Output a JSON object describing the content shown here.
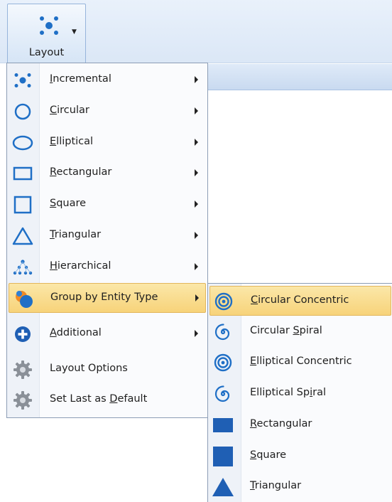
{
  "ribbon": {
    "layout_button": {
      "label": "Layout",
      "icon": "layout-dots-icon"
    }
  },
  "menu": {
    "items": [
      {
        "pre": "",
        "key": "I",
        "post": "ncremental",
        "icon": "incremental-dots-icon",
        "submenu": true
      },
      {
        "pre": "",
        "key": "C",
        "post": "ircular",
        "icon": "circle-outline-icon",
        "submenu": true
      },
      {
        "pre": "",
        "key": "E",
        "post": "lliptical",
        "icon": "ellipse-outline-icon",
        "submenu": true
      },
      {
        "pre": "",
        "key": "R",
        "post": "ectangular",
        "icon": "rectangle-outline-icon",
        "submenu": true
      },
      {
        "pre": "",
        "key": "S",
        "post": "quare",
        "icon": "square-outline-icon",
        "submenu": true
      },
      {
        "pre": "",
        "key": "T",
        "post": "riangular",
        "icon": "triangle-outline-icon",
        "submenu": true
      },
      {
        "pre": "",
        "key": "H",
        "post": "ierarchical",
        "icon": "hierarchy-dots-icon",
        "submenu": true
      },
      {
        "label": "Group by Entity Type",
        "icon": "entity-groups-icon",
        "submenu": true,
        "highlighted": true
      },
      {
        "pre": "",
        "key": "A",
        "post": "dditional",
        "icon": "plus-circle-icon",
        "submenu": true
      },
      {
        "label": "Layout Options",
        "icon": "gear-icon",
        "submenu": false
      },
      {
        "pre": "Set Last as ",
        "key": "D",
        "post": "efault",
        "icon": "gear-icon",
        "submenu": false
      }
    ]
  },
  "submenu": {
    "items": [
      {
        "pre": "",
        "key": "C",
        "post": "ircular Concentric",
        "icon": "concentric-circles-icon",
        "highlighted": true
      },
      {
        "pre": "Circular ",
        "key": "S",
        "post": "piral",
        "icon": "spiral-icon"
      },
      {
        "pre": "",
        "key": "E",
        "post": "lliptical Concentric",
        "icon": "concentric-circles-icon"
      },
      {
        "pre": "Elliptical Sp",
        "key": "i",
        "post": "ral",
        "icon": "spiral-icon"
      },
      {
        "pre": "",
        "key": "R",
        "post": "ectangular",
        "icon": "filled-rectangle-icon"
      },
      {
        "pre": "",
        "key": "S",
        "post": "quare",
        "icon": "filled-square-icon"
      },
      {
        "pre": "",
        "key": "T",
        "post": "riangular",
        "icon": "filled-triangle-icon"
      }
    ]
  },
  "colors": {
    "accent": "#1f6fc6",
    "highlight": "#f9dc8c",
    "gear": "#8a9098"
  }
}
